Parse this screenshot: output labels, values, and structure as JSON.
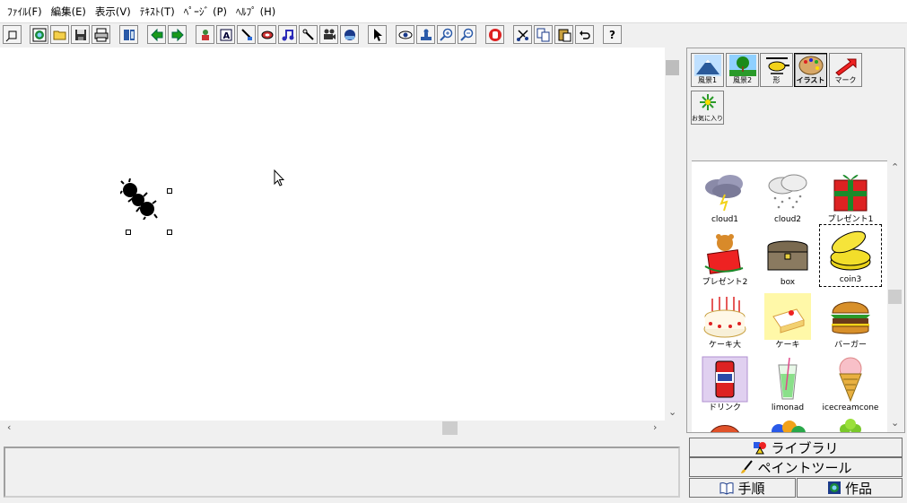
{
  "menu": [
    "ﾌｧｲﾙ(F)",
    "編集(E)",
    "表示(V)",
    "ﾃｷｽﾄ(T)",
    "ﾍﾟｰｼﾞ (P)",
    "ﾍﾙﾌﾟ (H)"
  ],
  "toolbar_help": "?",
  "categories": [
    "風景1",
    "風景2",
    "形",
    "イラスト",
    "マーク"
  ],
  "favorites": "お気に入り",
  "gallery": [
    {
      "name": "cloud1",
      "icon": "cloud-lightning"
    },
    {
      "name": "cloud2",
      "icon": "cloud-snow"
    },
    {
      "name": "プレゼント1",
      "icon": "gift-box"
    },
    {
      "name": "プレゼント2",
      "icon": "gift-teddy"
    },
    {
      "name": "box",
      "icon": "treasure-chest"
    },
    {
      "name": "coin3",
      "icon": "coin"
    },
    {
      "name": "ケーキ大",
      "icon": "big-cake"
    },
    {
      "name": "ケーキ",
      "icon": "cake-slice"
    },
    {
      "name": "バーガー",
      "icon": "burger"
    },
    {
      "name": "ドリンク",
      "icon": "soda-can"
    },
    {
      "name": "limonad",
      "icon": "lemonade-glass"
    },
    {
      "name": "icecreamcone",
      "icon": "ice-cream-cone"
    }
  ],
  "tabs": {
    "library": "ライブラリ",
    "paint_tool": "ペイントツール",
    "steps": "手順",
    "works": "作品"
  },
  "colors": {
    "accent": "#000080",
    "selection": "#000000"
  }
}
